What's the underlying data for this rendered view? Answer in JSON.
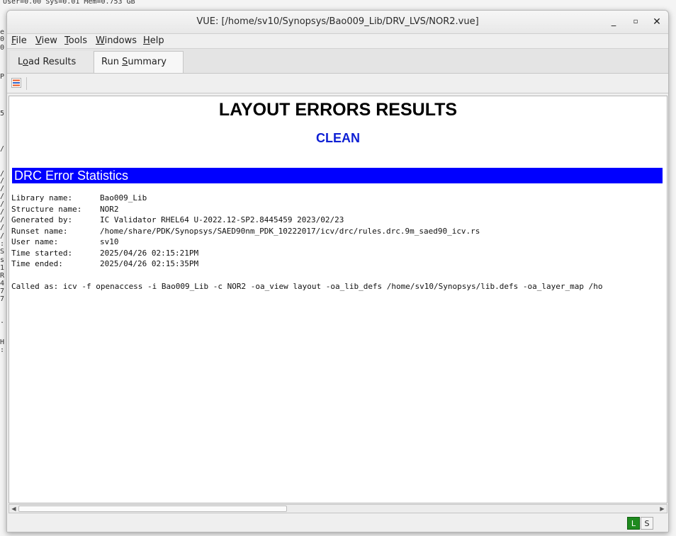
{
  "background_terminal": {
    "top_line": "User=0.00 Sys=0.01 Mem=0.753 GB",
    "left_fragments": [
      "e",
      "0",
      "0",
      "P",
      "5",
      "/",
      "/",
      "/",
      "/",
      "/",
      "/",
      "/",
      "/",
      "/",
      "/",
      ":",
      "S",
      "s",
      "1",
      "R",
      "4",
      "7",
      "7",
      ".",
      "H",
      ":"
    ]
  },
  "window": {
    "title": "VUE: [/home/sv10/Synopsys/Bao009_Lib/DRV_LVS/NOR2.vue]",
    "controls": {
      "minimize": "_",
      "maximize": "▫",
      "close": "✕"
    }
  },
  "menu": {
    "file": {
      "mnemonic": "F",
      "rest": "ile"
    },
    "view": {
      "mnemonic": "V",
      "rest": "iew"
    },
    "tools": {
      "mnemonic": "T",
      "rest": "ools"
    },
    "windows": {
      "mnemonic": "W",
      "rest": "indows"
    },
    "help": {
      "mnemonic": "H",
      "rest": "elp"
    }
  },
  "tabs": {
    "load_results": {
      "pre": "L",
      "mnemonic": "o",
      "post": "ad Results",
      "close": "✕"
    },
    "run_summary": {
      "pre": "Run ",
      "mnemonic": "S",
      "post": "ummary",
      "close": "✕",
      "active": true
    }
  },
  "toolbar": {
    "icon": "list-icon"
  },
  "report": {
    "title": "LAYOUT ERRORS RESULTS",
    "status": "CLEAN",
    "status_color": "#0d1fd4",
    "section_header": "DRC Error Statistics",
    "section_color": "#0000ff",
    "info": [
      {
        "label": "Library name:",
        "value": "Bao009_Lib"
      },
      {
        "label": "Structure name:",
        "value": "NOR2"
      },
      {
        "label": "Generated by:",
        "value": "IC Validator RHEL64 U-2022.12-SP2.8445459 2023/02/23"
      },
      {
        "label": "Runset name:",
        "value": "/home/share/PDK/Synopsys/SAED90nm_PDK_10222017/icv/drc/rules.drc.9m_saed90_icv.rs"
      },
      {
        "label": "User name:",
        "value": "sv10"
      },
      {
        "label": "Time started:",
        "value": "2025/04/26 02:15:21PM"
      },
      {
        "label": "Time ended:",
        "value": "2025/04/26 02:15:35PM"
      }
    ],
    "called_as": "Called as: icv -f openaccess -i Bao009_Lib -c NOR2 -oa_view layout -oa_lib_defs /home/sv10/Synopsys/lib.defs -oa_layer_map /ho"
  },
  "scrollbar": {
    "left_arrow": "◀",
    "right_arrow": "▶",
    "position_fraction": 0.0,
    "visible_fraction": 0.42
  },
  "status": {
    "l_label": "L",
    "s_label": "S",
    "l_color": "#1e8a1e"
  }
}
